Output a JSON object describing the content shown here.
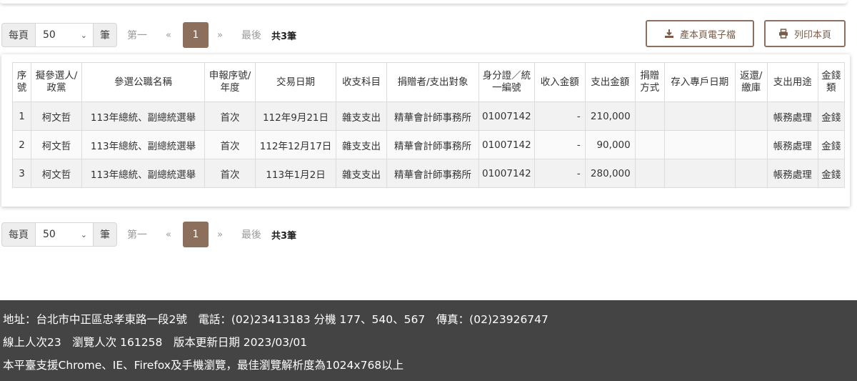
{
  "pager": {
    "per_page_label": "每頁",
    "per_page_value": "50",
    "unit_label": "筆",
    "first_label": "第一",
    "prev_label": "«",
    "current_page": "1",
    "next_label": "»",
    "last_label": "最後",
    "total_text": "共3筆"
  },
  "actions": {
    "export_label": "產本頁電子檔",
    "print_label": "列印本頁"
  },
  "table": {
    "headers": [
      "序號",
      "擬參選人/政黨",
      "參選公職名稱",
      "申報序號/年度",
      "交易日期",
      "收支科目",
      "捐贈者/支出對象",
      "身分證／統一編號",
      "收入金額",
      "支出金額",
      "捐贈方式",
      "存入專戶日期",
      "返還/繳庫",
      "支出用途",
      "金錢類"
    ],
    "rows": [
      [
        "1",
        "柯文哲",
        "113年總統、副總統選舉",
        "首次",
        "112年9月21日",
        "雜支支出",
        "精華會計師事務所",
        "01007142",
        "-",
        "210,000",
        "",
        "",
        "",
        "帳務處理",
        "金錢"
      ],
      [
        "2",
        "柯文哲",
        "113年總統、副總統選舉",
        "首次",
        "112年12月17日",
        "雜支支出",
        "精華會計師事務所",
        "01007142",
        "-",
        "90,000",
        "",
        "",
        "",
        "帳務處理",
        "金錢"
      ],
      [
        "3",
        "柯文哲",
        "113年總統、副總統選舉",
        "首次",
        "113年1月2日",
        "雜支支出",
        "精華會計師事務所",
        "01007142",
        "-",
        "280,000",
        "",
        "",
        "",
        "帳務處理",
        "金錢"
      ]
    ]
  },
  "footer": {
    "line1": "地址：台北市中正區忠孝東路一段2號　電話：(02)23413183 分機 177、540、567　傳真：(02)23926747",
    "line2": "線上人次23　瀏覽人次 161258　版本更新日期 2023/03/01",
    "line3": "本平臺支援Chrome、IE、Firefox及手機瀏覽，最佳瀏覽解析度為1024x768以上"
  }
}
